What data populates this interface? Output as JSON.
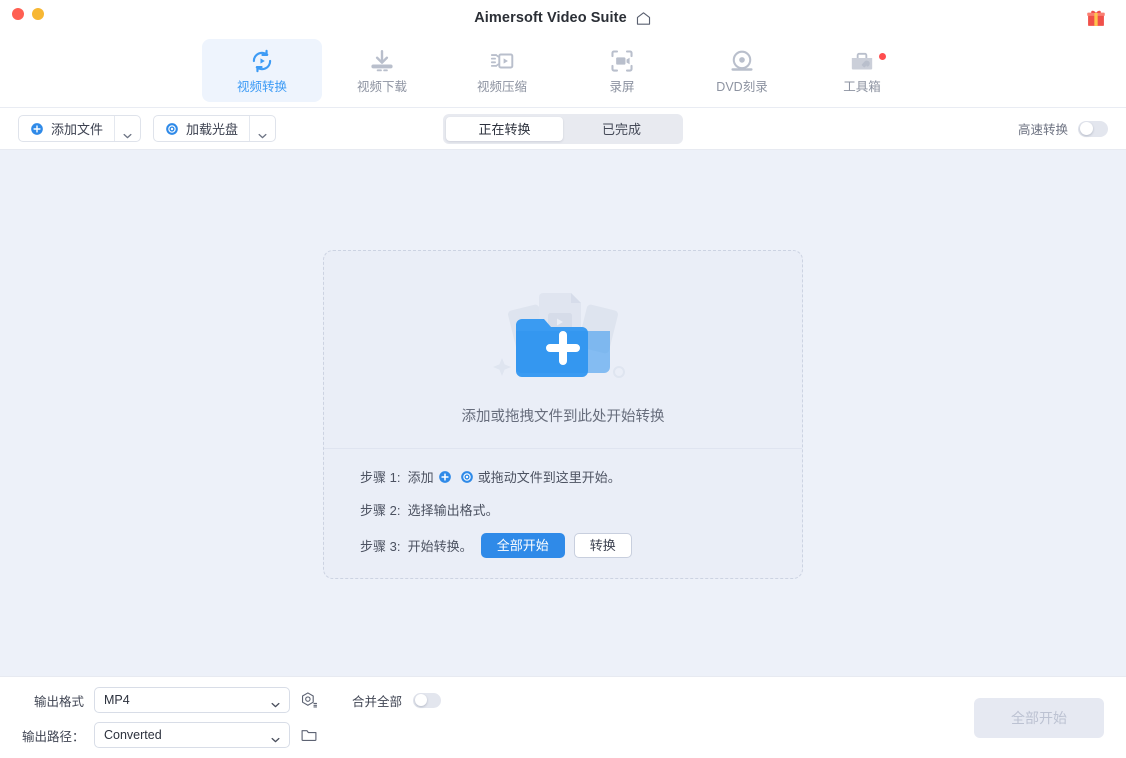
{
  "window": {
    "title": "Aimersoft Video Suite",
    "home_icon": "home-icon",
    "gift_icon": "gift-icon",
    "traffic_lights": [
      "close-red",
      "minimize-yellow"
    ]
  },
  "nav": {
    "items": [
      {
        "label": "视频转换",
        "icon": "convert-icon",
        "active": true,
        "badge": false
      },
      {
        "label": "视频下载",
        "icon": "download-icon",
        "active": false,
        "badge": false
      },
      {
        "label": "视频压缩",
        "icon": "compress-icon",
        "active": false,
        "badge": false
      },
      {
        "label": "录屏",
        "icon": "record-screen-icon",
        "active": false,
        "badge": false
      },
      {
        "label": "DVD刻录",
        "icon": "dvd-burn-icon",
        "active": false,
        "badge": false
      },
      {
        "label": "工具箱",
        "icon": "toolbox-icon",
        "active": false,
        "badge": true
      }
    ]
  },
  "toolbar": {
    "add_file_label": "添加文件",
    "add_file_icon": "plus-circle-icon",
    "load_disc_label": "加载光盘",
    "load_disc_icon": "disc-icon",
    "dropdown_icon": "chevron-down-icon",
    "tabs": [
      {
        "label": "正在转换",
        "active": true
      },
      {
        "label": "已完成",
        "active": false
      }
    ],
    "highspeed_label": "高速转换",
    "highspeed_on": false
  },
  "dropzone": {
    "caption": "添加或拖拽文件到此处开始转换",
    "art_icon": "add-folder-illustration",
    "steps": [
      {
        "prefix": "步骤 1:  添加",
        "icon1": "plus-circle-icon",
        "icon2": "disc-icon",
        "suffix": "或拖动文件到这里开始。"
      },
      {
        "prefix": "步骤 2:  选择输出格式。",
        "icon1": "",
        "icon2": "",
        "suffix": ""
      },
      {
        "prefix": "步骤 3:  开始转换。",
        "icon1": "",
        "icon2": "",
        "suffix": ""
      }
    ],
    "start_all_label": "全部开始",
    "convert_label": "转换"
  },
  "footer": {
    "format_label": "输出格式",
    "format_value": "MP4",
    "format_settings_icon": "format-settings-icon",
    "path_label": "输出路径：",
    "path_value": "Converted",
    "path_browse_icon": "folder-icon",
    "merge_label": "合并全部",
    "merge_on": false,
    "start_all_label": "全部开始",
    "dropdown_icon": "chevron-down-icon"
  },
  "colors": {
    "accent": "#2f8ae8",
    "accent_light": "#3d9bf5",
    "canvas": "#edf1f9",
    "panel": "#eaeef7",
    "badge_red": "#ff4d4f"
  }
}
